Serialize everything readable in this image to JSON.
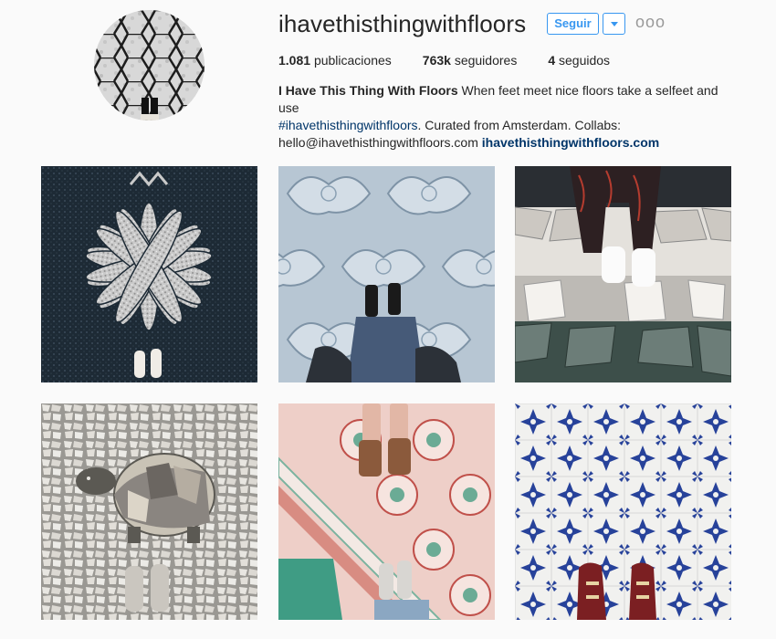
{
  "profile": {
    "username": "ihavethisthingwithfloors",
    "follow_label": "Seguir",
    "more_label": "ooo"
  },
  "stats": {
    "posts_count": "1.081",
    "posts_label": "publicaciones",
    "followers_count": "763k",
    "followers_label": "seguidores",
    "following_count": "4",
    "following_label": "seguidos"
  },
  "bio": {
    "name": "I Have This Thing With Floors",
    "text1": "When feet meet nice floors take a selfeet and use",
    "hashtag": "#ihavethisthingwithfloors",
    "text2": ". Curated from Amsterdam. Collabs:",
    "email": "hello@ihavethisthingwithfloors.com",
    "website": "ihavethisthingwithfloors.com"
  },
  "colors": {
    "accent": "#3897f0",
    "link": "#003569"
  },
  "posts": [
    {
      "icon": "lotus-mosaic-floor"
    },
    {
      "icon": "blue-cement-tile-floor"
    },
    {
      "icon": "broken-marble-floor"
    },
    {
      "icon": "turtle-mosaic-floor"
    },
    {
      "icon": "pink-patterned-tile-floor"
    },
    {
      "icon": "blue-azulejo-tile-floor"
    }
  ]
}
